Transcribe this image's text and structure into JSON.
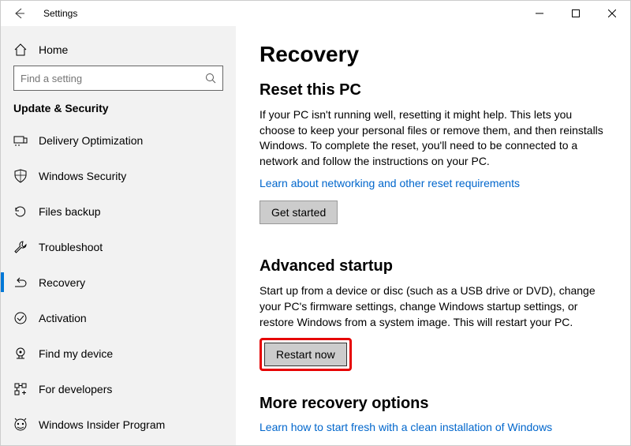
{
  "window": {
    "title": "Settings"
  },
  "sidebar": {
    "home_label": "Home",
    "search_placeholder": "Find a setting",
    "section": "Update & Security",
    "items": [
      {
        "label": "Delivery Optimization"
      },
      {
        "label": "Windows Security"
      },
      {
        "label": "Files backup"
      },
      {
        "label": "Troubleshoot"
      },
      {
        "label": "Recovery"
      },
      {
        "label": "Activation"
      },
      {
        "label": "Find my device"
      },
      {
        "label": "For developers"
      },
      {
        "label": "Windows Insider Program"
      }
    ]
  },
  "content": {
    "page_title": "Recovery",
    "reset": {
      "title": "Reset this PC",
      "body": "If your PC isn't running well, resetting it might help. This lets you choose to keep your personal files or remove them, and then reinstalls Windows. To complete the reset, you'll need to be connected to a network and follow the instructions on your PC.",
      "link": "Learn about networking and other reset requirements",
      "button": "Get started"
    },
    "advanced": {
      "title": "Advanced startup",
      "body": "Start up from a device or disc (such as a USB drive or DVD), change your PC's firmware settings, change Windows startup settings, or restore Windows from a system image. This will restart your PC.",
      "button": "Restart now"
    },
    "more": {
      "title": "More recovery options",
      "link": "Learn how to start fresh with a clean installation of Windows"
    }
  }
}
